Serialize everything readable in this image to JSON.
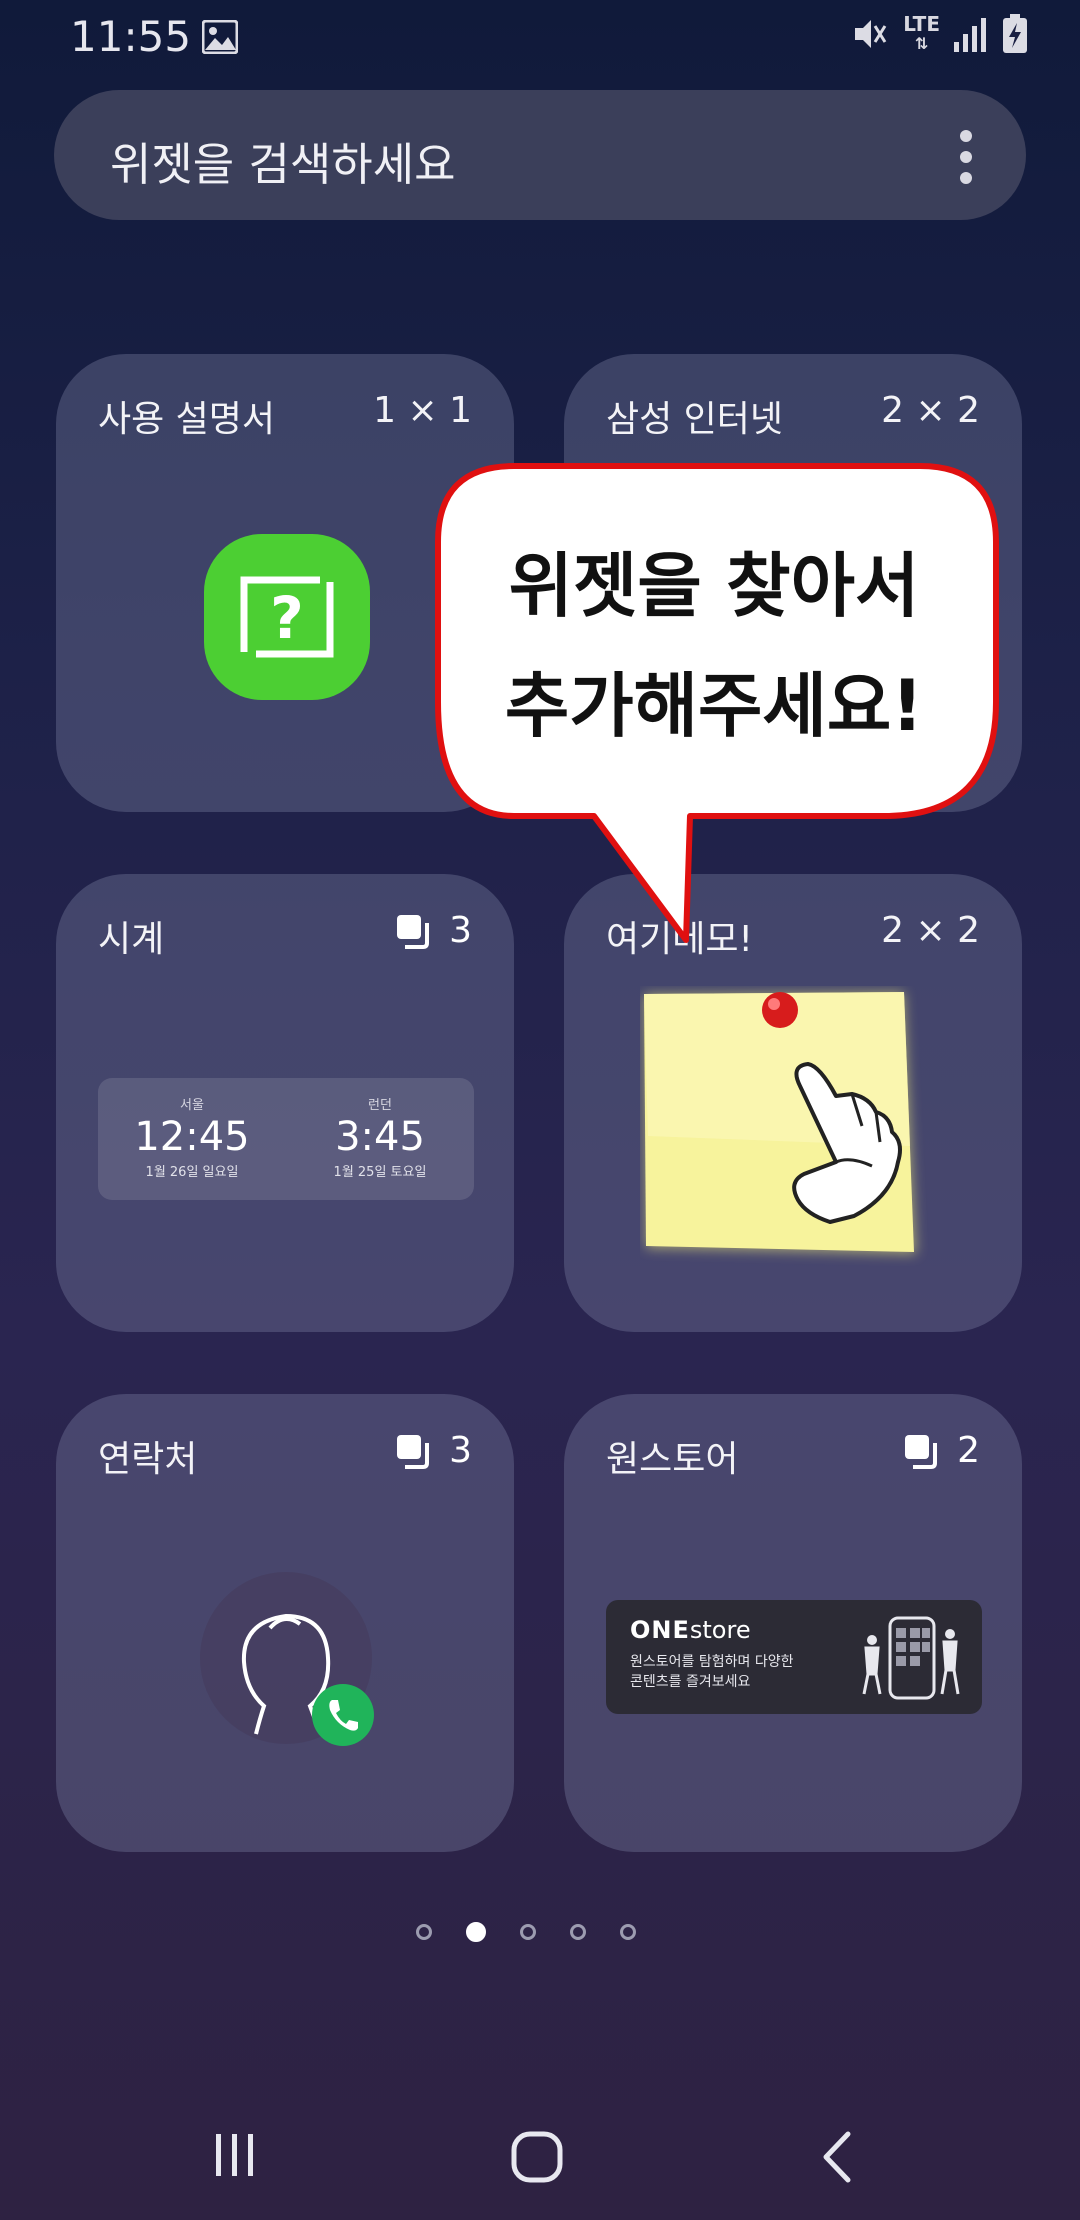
{
  "status_bar": {
    "time": "11:55",
    "network": "LTE"
  },
  "search": {
    "placeholder": "위젯을 검색하세요",
    "more_icon": "more-vert-icon"
  },
  "widgets": [
    {
      "title": "사용 설명서",
      "size": "1 × 1",
      "icon": "help-icon"
    },
    {
      "title": "삼성 인터넷",
      "size": "2 × 2"
    },
    {
      "title": "시계",
      "count": "3",
      "clocks": [
        {
          "city": "서울",
          "time": "12:45",
          "date": "1월 26일 일요일"
        },
        {
          "city": "런던",
          "time": "3:45",
          "date": "1월 25일 토요일"
        }
      ]
    },
    {
      "title": "여기메모!",
      "size": "2 × 2"
    },
    {
      "title": "연락처",
      "count": "3"
    },
    {
      "title": "원스토어",
      "count": "2",
      "banner": {
        "brand_bold": "ONE",
        "brand": "store",
        "line1": "원스토어를 탐험하며 다양한",
        "line2": "콘텐츠를 즐겨보세요"
      }
    }
  ],
  "callout": {
    "line1": "위젯을 찾아서",
    "line2": "추가해주세요!"
  },
  "pagination": {
    "pages": 5,
    "active": 2
  },
  "colors": {
    "background": "#1d2148",
    "card": "#4a4e70",
    "manual_green": "#4ccf33",
    "call_green": "#20b45a",
    "callout_border": "#e01010"
  }
}
